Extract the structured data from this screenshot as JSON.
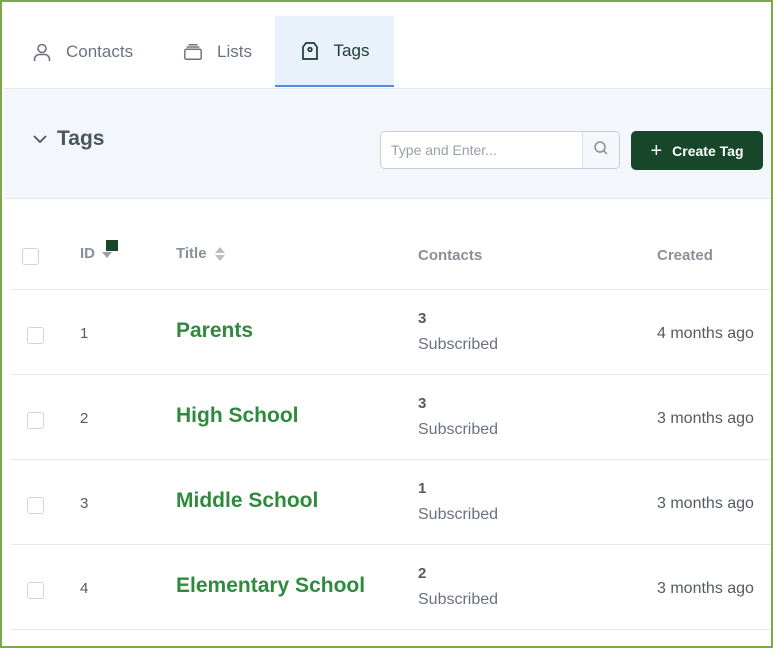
{
  "tabs": [
    {
      "label": "Contacts",
      "icon": "user-icon",
      "active": false
    },
    {
      "label": "Lists",
      "icon": "stack-icon",
      "active": false
    },
    {
      "label": "Tags",
      "icon": "tag-icon",
      "active": true
    }
  ],
  "header": {
    "title": "Tags",
    "search_placeholder": "Type and Enter...",
    "create_label": "Create Tag"
  },
  "table": {
    "columns": {
      "id": "ID",
      "title": "Title",
      "contacts": "Contacts",
      "created": "Created"
    },
    "rows": [
      {
        "id": "1",
        "title": "Parents",
        "count": "3",
        "status": "Subscribed",
        "created": "4 months ago"
      },
      {
        "id": "2",
        "title": "High School",
        "count": "3",
        "status": "Subscribed",
        "created": "3 months ago"
      },
      {
        "id": "3",
        "title": "Middle School",
        "count": "1",
        "status": "Subscribed",
        "created": "3 months ago"
      },
      {
        "id": "4",
        "title": "Elementary School",
        "count": "2",
        "status": "Subscribed",
        "created": "3 months ago"
      }
    ]
  },
  "colors": {
    "accent": "#17462a",
    "link": "#2f8a3d",
    "active_tab_bg": "#e9f1fb",
    "active_tab_border": "#4f8edc",
    "frame_border": "#7aa84a"
  }
}
